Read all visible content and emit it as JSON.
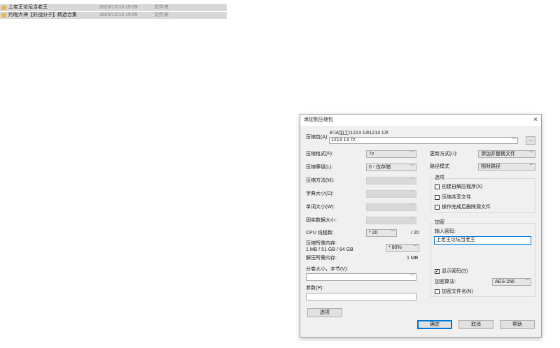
{
  "files": [
    {
      "name": "上老王论坛当老王",
      "date": "2025/12/13 15:59",
      "type": "文件夹"
    },
    {
      "name": "约啪大神【好战分子】精选合集",
      "date": "2025/12/13 15:59",
      "type": "文件夹"
    }
  ],
  "dialog": {
    "title": "添加到压缩包",
    "close": "×",
    "archive_label": "压缩包(A):",
    "archive_path": "E:\\A加工\\1213 13\\1213 13\\",
    "archive_name": "1213 13.7z",
    "browse_label": "...",
    "format_label": "压缩格式(F):",
    "format_value": "7z",
    "level_label": "压缩等级(L):",
    "level_value": "0 - 仅存储",
    "method_label": "压缩方法(M):",
    "dict_label": "字典大小(D):",
    "word_label": "单词大小(W):",
    "solid_label": "固实数据大小:",
    "threads_label": "CPU 线程数:",
    "threads_value": "* 20",
    "threads_max": "/ 20",
    "mem_comp_label": "压缩所需内存:",
    "mem_comp_value": "1 MB / 51 GB / 64 GB",
    "mem_percent": "* 80%",
    "mem_decomp_label": "解压所需内存:",
    "mem_decomp_value": "1 MB",
    "split_label": "分卷大小，字节(V):",
    "split_value": "",
    "params_label": "参数(P):",
    "params_value": "",
    "options_button": "选项",
    "update_label": "更新方式(U):",
    "update_value": "添加并替换文件",
    "path_label": "路径模式",
    "path_value": "相对路径",
    "options_group": "选项",
    "opt_sfx": "创建自解压程序(X)",
    "opt_shared": "压缩共享文件",
    "opt_delete": "操作完成后删除源文件",
    "encrypt_group": "加密",
    "password_label": "输入密码:",
    "password_value": "上老王论坛当老王",
    "show_password": "显示密码(S)",
    "enc_method_label": "加密算法:",
    "enc_method_value": "AES-256",
    "encrypt_names": "加密文件名(N)",
    "ok": "确定",
    "cancel": "取消",
    "help": "帮助"
  }
}
